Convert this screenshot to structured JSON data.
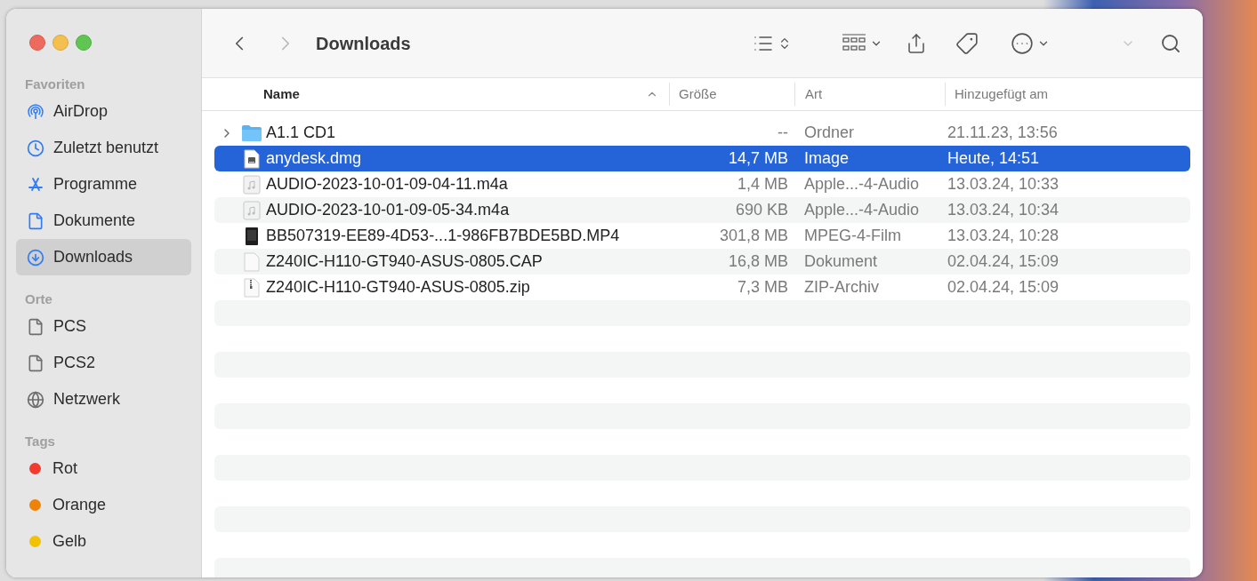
{
  "window": {
    "title": "Downloads"
  },
  "toolbar": {
    "back": {
      "disabled": false
    },
    "forward": {
      "disabled": true
    }
  },
  "sidebar": {
    "sections": [
      {
        "title": "Favoriten",
        "items": [
          {
            "label": "AirDrop",
            "kind": "airdrop",
            "selected": false
          },
          {
            "label": "Zuletzt benutzt",
            "kind": "recent",
            "selected": false
          },
          {
            "label": "Programme",
            "kind": "apps",
            "selected": false
          },
          {
            "label": "Dokumente",
            "kind": "document",
            "selected": false
          },
          {
            "label": "Downloads",
            "kind": "download",
            "selected": true
          }
        ]
      },
      {
        "title": "Orte",
        "items": [
          {
            "label": "PCS",
            "kind": "drive",
            "selected": false
          },
          {
            "label": "PCS2",
            "kind": "drive",
            "selected": false
          },
          {
            "label": "Netzwerk",
            "kind": "network",
            "selected": false
          }
        ]
      },
      {
        "title": "Tags",
        "items": [
          {
            "label": "Rot",
            "kind": "tag",
            "color": "#f23b30",
            "selected": false
          },
          {
            "label": "Orange",
            "kind": "tag",
            "color": "#ef8208",
            "selected": false
          },
          {
            "label": "Gelb",
            "kind": "tag",
            "color": "#f1c203",
            "selected": false
          }
        ]
      }
    ]
  },
  "table": {
    "columns": [
      {
        "label": "Name",
        "sorted": true
      },
      {
        "label": "Größe",
        "sorted": false
      },
      {
        "label": "Art",
        "sorted": false
      },
      {
        "label": "Hinzugefügt am",
        "sorted": false
      }
    ],
    "rows": [
      {
        "name": "A1.1 CD1",
        "size": "--",
        "type": "Ordner",
        "added": "21.11.23, 13:56",
        "kind": "folder",
        "expandable": true,
        "selected": false
      },
      {
        "name": "anydesk.dmg",
        "size": "14,7 MB",
        "type": "Image",
        "added": "Heute, 14:51",
        "kind": "disk",
        "expandable": false,
        "selected": true
      },
      {
        "name": "AUDIO-2023-10-01-09-04-11.m4a",
        "size": "1,4 MB",
        "type": "Apple...-4-Audio",
        "added": "13.03.24, 10:33",
        "kind": "audio",
        "expandable": false,
        "selected": false
      },
      {
        "name": "AUDIO-2023-10-01-09-05-34.m4a",
        "size": "690 KB",
        "type": "Apple...-4-Audio",
        "added": "13.03.24, 10:34",
        "kind": "audio",
        "expandable": false,
        "selected": false
      },
      {
        "name": "BB507319-EE89-4D53-...1-986FB7BDE5BD.MP4",
        "size": "301,8 MB",
        "type": "MPEG-4-Film",
        "added": "13.03.24, 10:28",
        "kind": "video",
        "expandable": false,
        "selected": false
      },
      {
        "name": "Z240IC-H110-GT940-ASUS-0805.CAP",
        "size": "16,8 MB",
        "type": "Dokument",
        "added": "02.04.24, 15:09",
        "kind": "document",
        "expandable": false,
        "selected": false
      },
      {
        "name": "Z240IC-H110-GT940-ASUS-0805.zip",
        "size": "7,3 MB",
        "type": "ZIP-Archiv",
        "added": "02.04.24, 15:09",
        "kind": "zip",
        "expandable": false,
        "selected": false
      }
    ]
  }
}
